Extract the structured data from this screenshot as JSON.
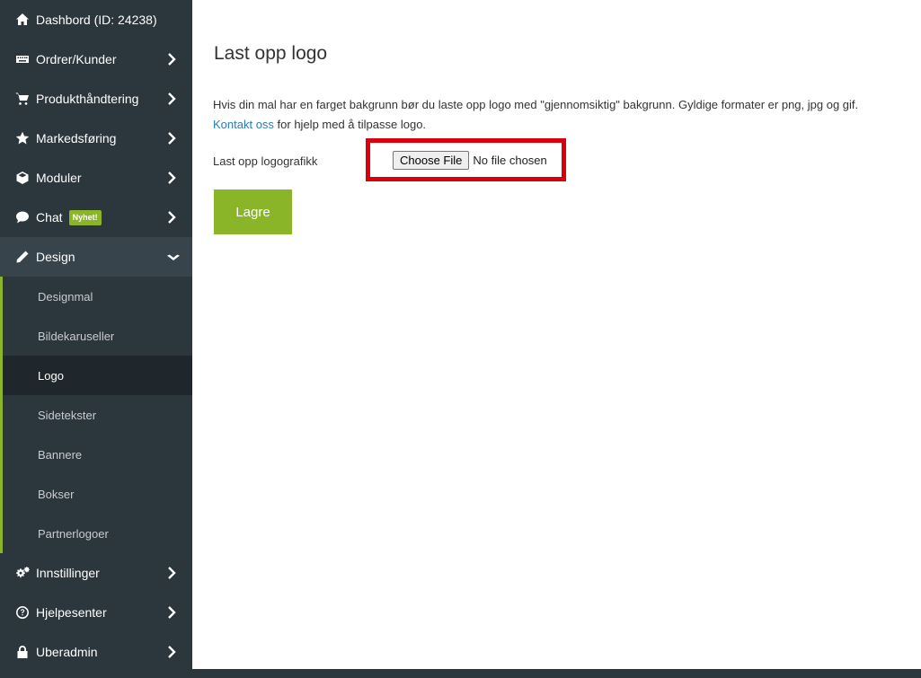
{
  "sidebar": {
    "items": [
      {
        "label": "Dashbord (ID: 24238)",
        "icon": "home-icon"
      },
      {
        "label": "Ordrer/Kunder",
        "icon": "keyboard-icon"
      },
      {
        "label": "Produkthåndtering",
        "icon": "cart-icon"
      },
      {
        "label": "Markedsføring",
        "icon": "star-icon"
      },
      {
        "label": "Moduler",
        "icon": "cube-icon"
      },
      {
        "label": "Chat",
        "icon": "chat-bubble-icon",
        "badge": "Nyhet!"
      },
      {
        "label": "Design",
        "icon": "pencil-icon"
      },
      {
        "label": "Innstillinger",
        "icon": "gears-icon"
      },
      {
        "label": "Hjelpesenter",
        "icon": "question-circle-icon"
      },
      {
        "label": "Uberadmin",
        "icon": "lock-icon"
      }
    ],
    "design_submenu": [
      {
        "label": "Designmal"
      },
      {
        "label": "Bildekaruseller"
      },
      {
        "label": "Logo"
      },
      {
        "label": "Sidetekster"
      },
      {
        "label": "Bannere"
      },
      {
        "label": "Bokser"
      },
      {
        "label": "Partnerlogoer"
      }
    ],
    "active_submenu_item": "Logo"
  },
  "main": {
    "title": "Last opp logo",
    "description": "Hvis din mal har en farget bakgrunn bør du laste opp logo med \"gjennomsiktig\" bakgrunn. Gyldige formater er png, jpg og gif.",
    "contact_link": "Kontakt oss",
    "contact_suffix": " for hjelp med å tilpasse logo.",
    "upload_label": "Last opp logografikk",
    "file_button": "Choose File",
    "file_status": "No file chosen",
    "save_label": "Lagre"
  },
  "colors": {
    "sidebar_bg": "#2c363d",
    "accent_green": "#8ab528",
    "highlight_red": "#d9000d",
    "link_blue": "#2b7bb9"
  }
}
